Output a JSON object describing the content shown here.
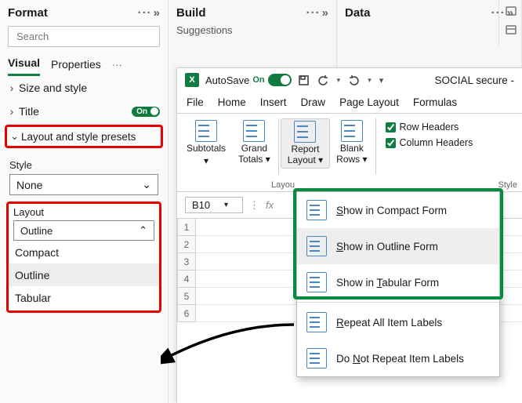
{
  "panes": {
    "format": {
      "title": "Format",
      "search_placeholder": "Search",
      "tabs": {
        "visual": "Visual",
        "properties": "Properties"
      },
      "sections": {
        "size_style": "Size and style",
        "title": "Title",
        "title_toggle": "On",
        "layout_presets": "Layout and style presets"
      },
      "style": {
        "label": "Style",
        "value": "None"
      },
      "layout": {
        "label": "Layout",
        "value": "Outline",
        "options": [
          "Compact",
          "Outline",
          "Tabular"
        ]
      }
    },
    "build": {
      "title": "Build",
      "subtitle": "Suggestions"
    },
    "data": {
      "title": "Data"
    }
  },
  "excel": {
    "autosave_label": "AutoSave",
    "autosave_state": "On",
    "doc_title": "SOCIAL secure -",
    "tabs": [
      "File",
      "Home",
      "Insert",
      "Draw",
      "Page Layout",
      "Formulas"
    ],
    "ribbon": {
      "subtotals": "Subtotals",
      "grand_totals_l1": "Grand",
      "grand_totals_l2": "Totals",
      "report_layout_l1": "Report",
      "report_layout_l2": "Layout",
      "blank_rows_l1": "Blank",
      "blank_rows_l2": "Rows",
      "group_label_layout": "Layou",
      "group_label_style": "Style",
      "row_headers": "Row Headers",
      "column_headers": "Column Headers"
    },
    "name_box": "B10",
    "rows": [
      "1",
      "2",
      "3",
      "4",
      "5",
      "6"
    ],
    "menu": {
      "compact": "how in Compact Form",
      "compact_u": "S",
      "outline": "how in Outline Form",
      "outline_u": "S",
      "tabular": "abular Form",
      "tabular_pre": "Show in ",
      "tabular_u": "T",
      "repeat": "epeat All Item Labels",
      "repeat_u": "R",
      "norepeat_pre": "Do ",
      "norepeat_u": "N",
      "norepeat": "ot Repeat Item Labels"
    }
  }
}
